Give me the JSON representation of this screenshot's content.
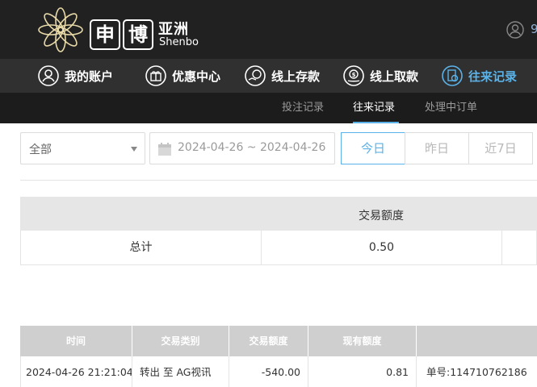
{
  "header": {
    "logo_chars": [
      "申",
      "博"
    ],
    "logo_cn": "亚洲",
    "logo_en": "Shenbo",
    "user_text": "9"
  },
  "nav": [
    {
      "label": "我的账户",
      "icon": "user-icon"
    },
    {
      "label": "优惠中心",
      "icon": "gift-icon"
    },
    {
      "label": "线上存款",
      "icon": "deposit-icon"
    },
    {
      "label": "线上取款",
      "icon": "withdraw-icon"
    },
    {
      "label": "往来记录",
      "icon": "records-icon",
      "active": true
    }
  ],
  "subnav": [
    {
      "label": "投注记录"
    },
    {
      "label": "往来记录",
      "active": true
    },
    {
      "label": "处理中订单"
    }
  ],
  "filter": {
    "type_value": "全部",
    "date_range": "2024-04-26 ~ 2024-04-26",
    "day_buttons": [
      "今日",
      "昨日",
      "近7日"
    ]
  },
  "summary": {
    "header": "交易额度",
    "total_label": "总计",
    "total_value": "0.50"
  },
  "table": {
    "columns": [
      "时间",
      "交易类别",
      "交易额度",
      "现有额度",
      ""
    ],
    "rows": [
      {
        "time": "2024-04-26 21:21:04",
        "type": "转出 至 AG视讯",
        "amount": "-540.00",
        "balance": "0.81",
        "note": "单号:114710762186"
      }
    ]
  },
  "colors": {
    "accent": "#5ab2e8",
    "topbar": "#212121",
    "navbar": "#303030"
  }
}
